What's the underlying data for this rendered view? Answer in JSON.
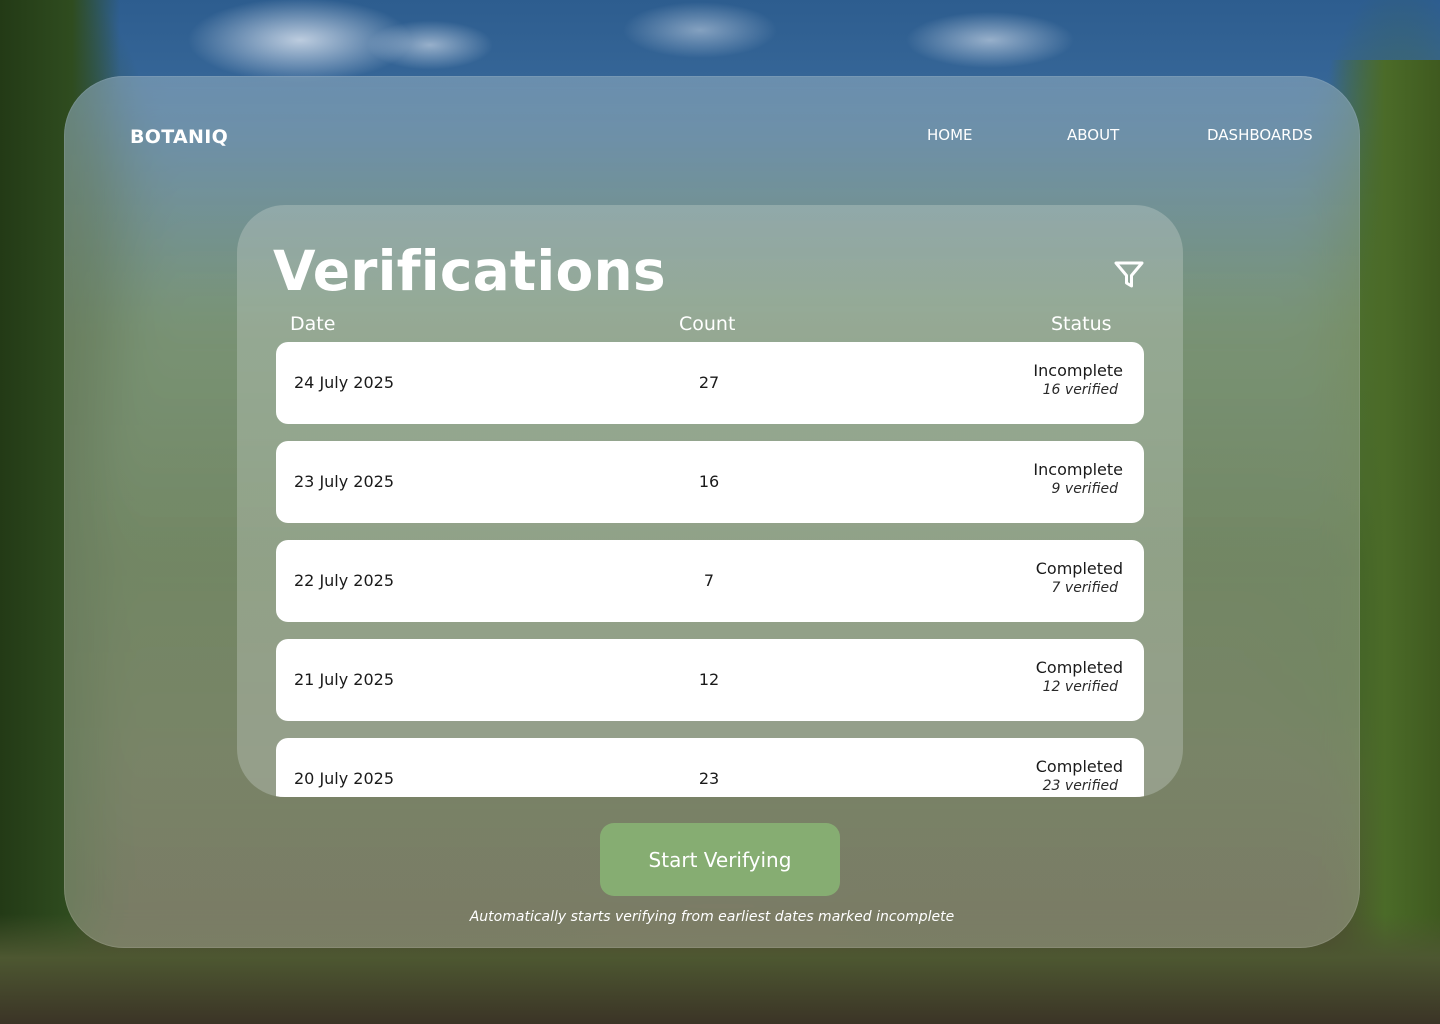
{
  "brand": "BOTANIQ",
  "nav": {
    "home": "HOME",
    "about": "ABOUT",
    "dashboards": "DASHBOARDS"
  },
  "page_title": "Verifications",
  "columns": {
    "date": "Date",
    "count": "Count",
    "status": "Status"
  },
  "rows": [
    {
      "date": "24 July 2025",
      "count": "27",
      "status": "Incomplete",
      "verified": "16 verified"
    },
    {
      "date": "23 July 2025",
      "count": "16",
      "status": "Incomplete",
      "verified": "9 verified"
    },
    {
      "date": "22 July 2025",
      "count": "7",
      "status": "Completed",
      "verified": "7 verified"
    },
    {
      "date": "21 July 2025",
      "count": "12",
      "status": "Completed",
      "verified": "12 verified"
    },
    {
      "date": "20 July 2025",
      "count": "23",
      "status": "Completed",
      "verified": "23 verified"
    }
  ],
  "cta": {
    "label": "Start Verifying",
    "note": "Automatically starts verifying from earliest dates marked incomplete"
  },
  "icons": {
    "filter": "filter-icon"
  },
  "colors": {
    "cta_background": "#86ad72",
    "text_on_glass": "#ffffff",
    "row_background": "#ffffff"
  }
}
